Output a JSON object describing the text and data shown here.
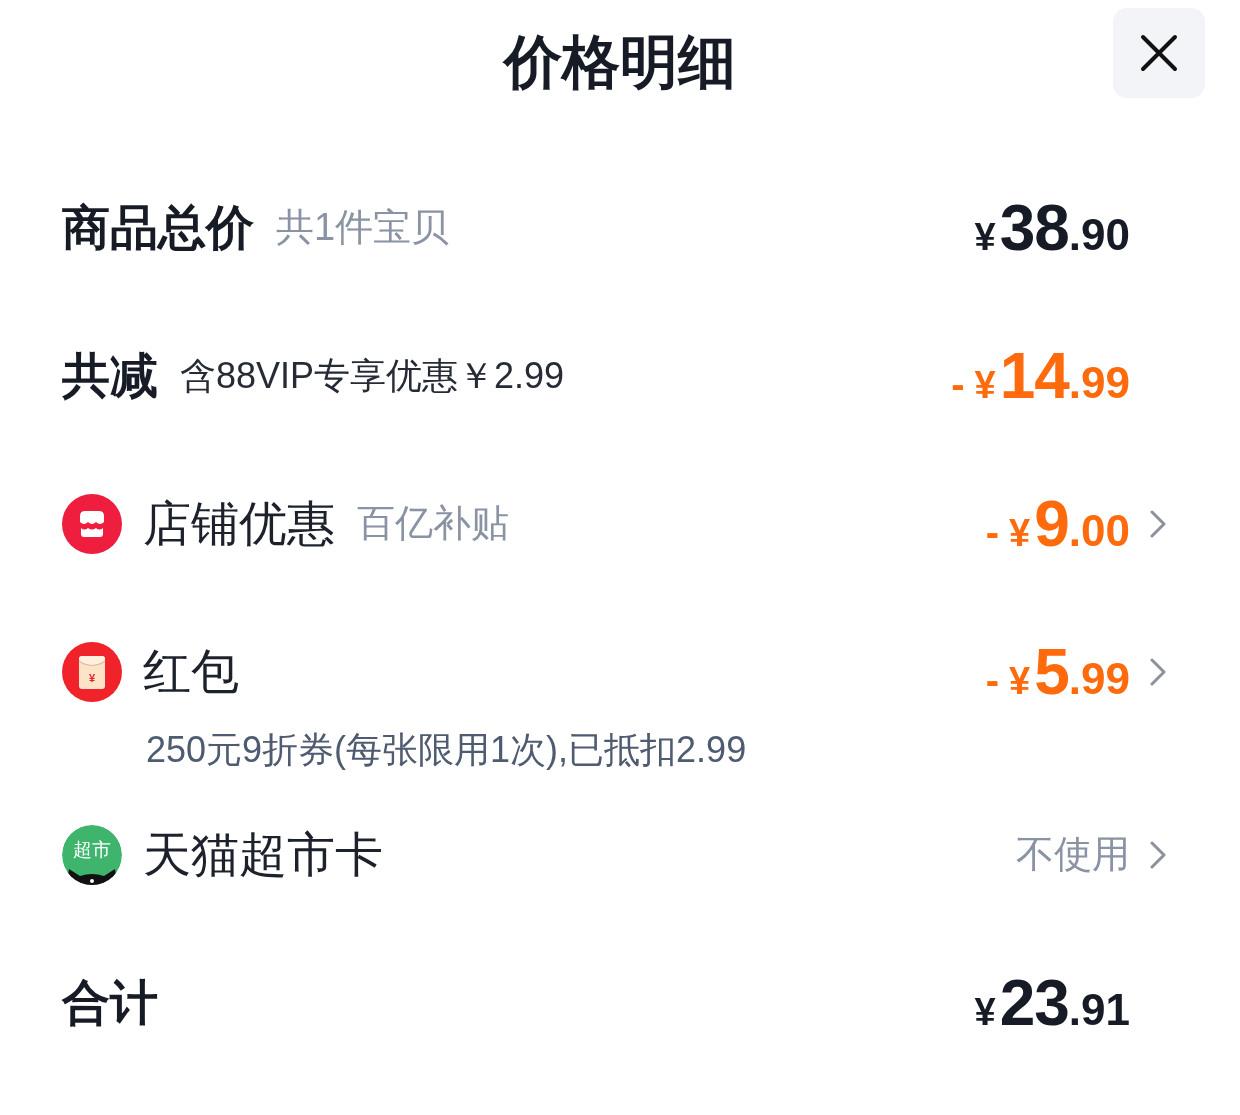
{
  "header": {
    "title": "价格明细"
  },
  "rows": [
    {
      "kind": "heading",
      "label": "商品总价",
      "note": "共1件宝贝",
      "note_muted": true,
      "amount": {
        "currency": "¥",
        "whole": "38",
        "fraction": ".90"
      },
      "highlight": false
    },
    {
      "kind": "heading",
      "label": "共减",
      "note": "含88VIP专享优惠￥2.99",
      "note_muted": false,
      "amount": {
        "sign": "-",
        "currency": "¥",
        "whole": "14",
        "fraction": ".99"
      },
      "highlight": true
    },
    {
      "kind": "shop",
      "label": "店铺优惠",
      "note": "百亿补贴",
      "note_muted": true,
      "amount": {
        "sign": "-",
        "currency": "¥",
        "whole": "9",
        "fraction": ".00"
      },
      "highlight": true
    },
    {
      "kind": "packet",
      "icon_text": "¥",
      "label": "红包",
      "amount": {
        "sign": "-",
        "currency": "¥",
        "whole": "5",
        "fraction": ".99"
      },
      "highlight": true,
      "detail": "250元9折券(每张限用1次),已抵扣2.99"
    },
    {
      "kind": "card",
      "icon_text": "超市",
      "label": "天猫超市卡",
      "value": "不使用"
    },
    {
      "kind": "heading",
      "label": "合计",
      "amount": {
        "currency": "¥",
        "whole": "23",
        "fraction": ".91"
      },
      "highlight": false
    }
  ]
}
